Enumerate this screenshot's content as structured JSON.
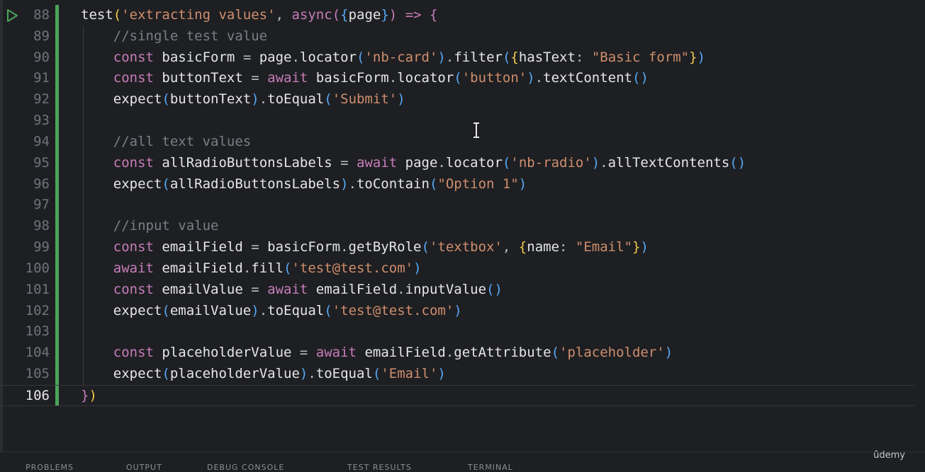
{
  "editor": {
    "current_line": "106",
    "lines": [
      {
        "num": "88",
        "current": false,
        "guide": false,
        "t": [
          [
            "fn",
            "test"
          ],
          [
            "bk1",
            "("
          ],
          [
            "st",
            "'extracting values'"
          ],
          [
            "op",
            ", "
          ],
          [
            "kw",
            "async"
          ],
          [
            "bk2",
            "("
          ],
          [
            "bk3",
            "{"
          ],
          [
            "fn",
            "page"
          ],
          [
            "bk3",
            "}"
          ],
          [
            "bk2",
            ")"
          ],
          [
            "op",
            " "
          ],
          [
            "kw",
            "=>"
          ],
          [
            "op",
            " "
          ],
          [
            "bk2",
            "{"
          ]
        ]
      },
      {
        "num": "89",
        "current": false,
        "guide": true,
        "t": [
          [
            "op",
            "    "
          ],
          [
            "cm",
            "//single test value"
          ]
        ]
      },
      {
        "num": "90",
        "current": false,
        "guide": true,
        "t": [
          [
            "op",
            "    "
          ],
          [
            "kw",
            "const"
          ],
          [
            "op",
            " "
          ],
          [
            "fn",
            "basicForm"
          ],
          [
            "op",
            " = "
          ],
          [
            "fn",
            "page"
          ],
          [
            "op",
            "."
          ],
          [
            "fn",
            "locator"
          ],
          [
            "bk3",
            "("
          ],
          [
            "st",
            "'nb-card'"
          ],
          [
            "bk3",
            ")"
          ],
          [
            "op",
            "."
          ],
          [
            "fn",
            "filter"
          ],
          [
            "bk3",
            "("
          ],
          [
            "bk1",
            "{"
          ],
          [
            "fn",
            "hasText"
          ],
          [
            "op",
            ": "
          ],
          [
            "st",
            "\"Basic form\""
          ],
          [
            "bk1",
            "}"
          ],
          [
            "bk3",
            ")"
          ]
        ]
      },
      {
        "num": "91",
        "current": false,
        "guide": true,
        "t": [
          [
            "op",
            "    "
          ],
          [
            "kw",
            "const"
          ],
          [
            "op",
            " "
          ],
          [
            "fn",
            "buttonText"
          ],
          [
            "op",
            " = "
          ],
          [
            "kw",
            "await"
          ],
          [
            "op",
            " "
          ],
          [
            "fn",
            "basicForm"
          ],
          [
            "op",
            "."
          ],
          [
            "fn",
            "locator"
          ],
          [
            "bk3",
            "("
          ],
          [
            "st",
            "'button'"
          ],
          [
            "bk3",
            ")"
          ],
          [
            "op",
            "."
          ],
          [
            "fn",
            "textContent"
          ],
          [
            "bk3",
            "()"
          ]
        ]
      },
      {
        "num": "92",
        "current": false,
        "guide": true,
        "t": [
          [
            "op",
            "    "
          ],
          [
            "fn",
            "expect"
          ],
          [
            "bk3",
            "("
          ],
          [
            "fn",
            "buttonText"
          ],
          [
            "bk3",
            ")"
          ],
          [
            "op",
            "."
          ],
          [
            "fn",
            "toEqual"
          ],
          [
            "bk3",
            "("
          ],
          [
            "st",
            "'Submit'"
          ],
          [
            "bk3",
            ")"
          ]
        ]
      },
      {
        "num": "93",
        "current": false,
        "guide": true,
        "t": []
      },
      {
        "num": "94",
        "current": false,
        "guide": true,
        "t": [
          [
            "op",
            "    "
          ],
          [
            "cm",
            "//all text values"
          ]
        ]
      },
      {
        "num": "95",
        "current": false,
        "guide": true,
        "t": [
          [
            "op",
            "    "
          ],
          [
            "kw",
            "const"
          ],
          [
            "op",
            " "
          ],
          [
            "fn",
            "allRadioButtonsLabels"
          ],
          [
            "op",
            " = "
          ],
          [
            "kw",
            "await"
          ],
          [
            "op",
            " "
          ],
          [
            "fn",
            "page"
          ],
          [
            "op",
            "."
          ],
          [
            "fn",
            "locator"
          ],
          [
            "bk3",
            "("
          ],
          [
            "st",
            "'nb-radio'"
          ],
          [
            "bk3",
            ")"
          ],
          [
            "op",
            "."
          ],
          [
            "fn",
            "allTextContents"
          ],
          [
            "bk3",
            "()"
          ]
        ]
      },
      {
        "num": "96",
        "current": false,
        "guide": true,
        "t": [
          [
            "op",
            "    "
          ],
          [
            "fn",
            "expect"
          ],
          [
            "bk3",
            "("
          ],
          [
            "fn",
            "allRadioButtonsLabels"
          ],
          [
            "bk3",
            ")"
          ],
          [
            "op",
            "."
          ],
          [
            "fn",
            "toContain"
          ],
          [
            "bk3",
            "("
          ],
          [
            "st",
            "\"Option 1\""
          ],
          [
            "bk3",
            ")"
          ]
        ]
      },
      {
        "num": "97",
        "current": false,
        "guide": true,
        "t": []
      },
      {
        "num": "98",
        "current": false,
        "guide": true,
        "t": [
          [
            "op",
            "    "
          ],
          [
            "cm",
            "//input value"
          ]
        ]
      },
      {
        "num": "99",
        "current": false,
        "guide": true,
        "t": [
          [
            "op",
            "    "
          ],
          [
            "kw",
            "const"
          ],
          [
            "op",
            " "
          ],
          [
            "fn",
            "emailField"
          ],
          [
            "op",
            " = "
          ],
          [
            "fn",
            "basicForm"
          ],
          [
            "op",
            "."
          ],
          [
            "fn",
            "getByRole"
          ],
          [
            "bk3",
            "("
          ],
          [
            "st",
            "'textbox'"
          ],
          [
            "op",
            ", "
          ],
          [
            "bk1",
            "{"
          ],
          [
            "fn",
            "name"
          ],
          [
            "op",
            ": "
          ],
          [
            "st",
            "\"Email\""
          ],
          [
            "bk1",
            "}"
          ],
          [
            "bk3",
            ")"
          ]
        ]
      },
      {
        "num": "100",
        "current": false,
        "guide": true,
        "t": [
          [
            "op",
            "    "
          ],
          [
            "kw",
            "await"
          ],
          [
            "op",
            " "
          ],
          [
            "fn",
            "emailField"
          ],
          [
            "op",
            "."
          ],
          [
            "fn",
            "fill"
          ],
          [
            "bk3",
            "("
          ],
          [
            "st",
            "'test@test.com'"
          ],
          [
            "bk3",
            ")"
          ]
        ]
      },
      {
        "num": "101",
        "current": false,
        "guide": true,
        "t": [
          [
            "op",
            "    "
          ],
          [
            "kw",
            "const"
          ],
          [
            "op",
            " "
          ],
          [
            "fn",
            "emailValue"
          ],
          [
            "op",
            " = "
          ],
          [
            "kw",
            "await"
          ],
          [
            "op",
            " "
          ],
          [
            "fn",
            "emailField"
          ],
          [
            "op",
            "."
          ],
          [
            "fn",
            "inputValue"
          ],
          [
            "bk3",
            "()"
          ]
        ]
      },
      {
        "num": "102",
        "current": false,
        "guide": true,
        "t": [
          [
            "op",
            "    "
          ],
          [
            "fn",
            "expect"
          ],
          [
            "bk3",
            "("
          ],
          [
            "fn",
            "emailValue"
          ],
          [
            "bk3",
            ")"
          ],
          [
            "op",
            "."
          ],
          [
            "fn",
            "toEqual"
          ],
          [
            "bk3",
            "("
          ],
          [
            "st",
            "'test@test.com'"
          ],
          [
            "bk3",
            ")"
          ]
        ]
      },
      {
        "num": "103",
        "current": false,
        "guide": true,
        "t": []
      },
      {
        "num": "104",
        "current": false,
        "guide": true,
        "t": [
          [
            "op",
            "    "
          ],
          [
            "kw",
            "const"
          ],
          [
            "op",
            " "
          ],
          [
            "fn",
            "placeholderValue"
          ],
          [
            "op",
            " = "
          ],
          [
            "kw",
            "await"
          ],
          [
            "op",
            " "
          ],
          [
            "fn",
            "emailField"
          ],
          [
            "op",
            "."
          ],
          [
            "fn",
            "getAttribute"
          ],
          [
            "bk3",
            "("
          ],
          [
            "st",
            "'placeholder'"
          ],
          [
            "bk3",
            ")"
          ]
        ]
      },
      {
        "num": "105",
        "current": false,
        "guide": true,
        "t": [
          [
            "op",
            "    "
          ],
          [
            "fn",
            "expect"
          ],
          [
            "bk3",
            "("
          ],
          [
            "fn",
            "placeholderValue"
          ],
          [
            "bk3",
            ")"
          ],
          [
            "op",
            "."
          ],
          [
            "fn",
            "toEqual"
          ],
          [
            "bk3",
            "("
          ],
          [
            "st",
            "'Email'"
          ],
          [
            "bk3",
            ")"
          ]
        ]
      },
      {
        "num": "106",
        "current": true,
        "guide": false,
        "t": [
          [
            "bk2",
            "}"
          ],
          [
            "bk1",
            ")"
          ]
        ]
      }
    ]
  },
  "bottom_tabs": [
    "PROBLEMS",
    "OUTPUT",
    "DEBUG CONSOLE",
    "TEST RESULTS",
    "TERMINAL"
  ],
  "watermark": "ûdemy",
  "colors": {
    "background": "#1e1f22",
    "keyword": "#c77dbb",
    "string": "#cf8e6d",
    "comment": "#7a7e85",
    "modified_marker": "#4ca35a",
    "run_icon": "#4ca35a"
  },
  "icons": [
    "run-test-icon",
    "text-cursor-icon"
  ]
}
